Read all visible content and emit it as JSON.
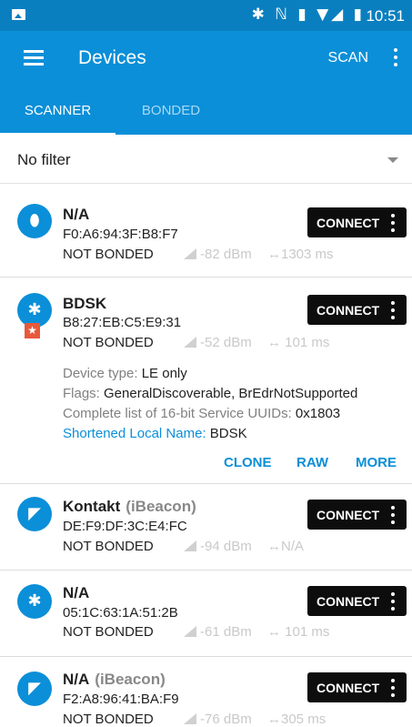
{
  "statusbar": {
    "icons": "✱ ℕ ▮ ▼◢ ▮",
    "time": "10:51"
  },
  "appbar": {
    "title": "Devices",
    "scan_label": "SCAN"
  },
  "tabs": [
    {
      "label": "SCANNER"
    },
    {
      "label": "BONDED"
    }
  ],
  "filter": {
    "selected": "No filter"
  },
  "devices": [
    {
      "name": "N/A",
      "type": "",
      "address": "F0:A6:94:3F:B8:F7",
      "bond": "NOT BONDED",
      "rssi": "-82 dBm",
      "interval": "↔1303 ms",
      "connect_label": "CONNECT",
      "icon": "generic-device-icon"
    },
    {
      "name": "BDSK",
      "type": "",
      "address": "B8:27:EB:C5:E9:31",
      "bond": "NOT BONDED",
      "rssi": "-52 dBm",
      "interval": "↔ 101 ms",
      "connect_label": "CONNECT",
      "icon": "bluetooth-icon",
      "favorite": true,
      "details": {
        "device_type_key": "Device type: ",
        "device_type_val": "LE only",
        "flags_key": "Flags: ",
        "flags_val": "GeneralDiscoverable, BrEdrNotSupported",
        "uuids_key": "Complete list of 16-bit Service UUIDs: ",
        "uuids_val": "0x1803",
        "local_name_key": "Shortened Local Name: ",
        "local_name_val": "BDSK"
      },
      "actions": {
        "clone": "CLONE",
        "raw": "RAW",
        "more": "MORE"
      }
    },
    {
      "name": "Kontakt",
      "type": "(iBeacon)",
      "address": "DE:F9:DF:3C:E4:FC",
      "bond": "NOT BONDED",
      "rssi": "-94 dBm",
      "interval": "↔N/A",
      "connect_label": "CONNECT",
      "icon": "beacon-icon"
    },
    {
      "name": "N/A",
      "type": "",
      "address": "05:1C:63:1A:51:2B",
      "bond": "NOT BONDED",
      "rssi": "-61 dBm",
      "interval": "↔ 101 ms",
      "connect_label": "CONNECT",
      "icon": "bluetooth-icon"
    },
    {
      "name": "N/A",
      "type": "(iBeacon)",
      "address": "F2:A8:96:41:BA:F9",
      "bond": "NOT BONDED",
      "rssi": "-76 dBm",
      "interval": "↔305 ms",
      "connect_label": "CONNECT",
      "icon": "beacon-icon"
    }
  ]
}
